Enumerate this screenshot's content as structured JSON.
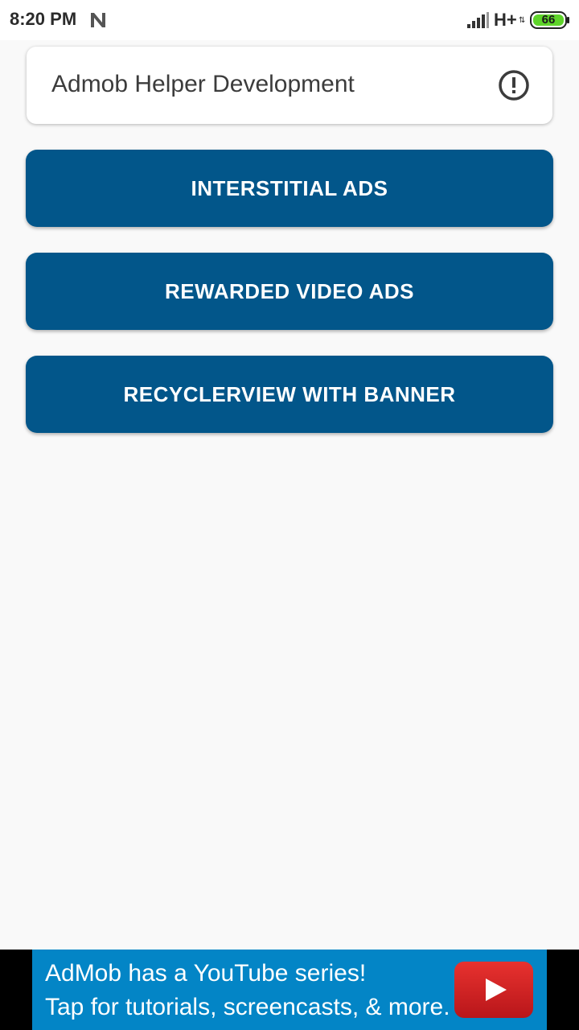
{
  "status_bar": {
    "time": "8:20 PM",
    "network": "H+",
    "network_arrows": "⇅",
    "battery_level": "66",
    "icons": [
      "n-notification-icon",
      "signal-icon",
      "battery-icon"
    ]
  },
  "header": {
    "title": "Admob Helper Development",
    "info_icon": "info-alert-icon"
  },
  "buttons": [
    {
      "label": "INTERSTITIAL ADS"
    },
    {
      "label": "REWARDED VIDEO ADS"
    },
    {
      "label": "RECYCLERVIEW WITH BANNER"
    }
  ],
  "ad_banner": {
    "line1": "AdMob has a YouTube series!",
    "line2": "Tap for tutorials, screencasts, & more.",
    "icon": "youtube-play-icon"
  },
  "colors": {
    "button_bg": "#02568a",
    "ad_bg": "#0385c6",
    "youtube_red": "#d9221f",
    "battery_green": "#5fd42a"
  }
}
